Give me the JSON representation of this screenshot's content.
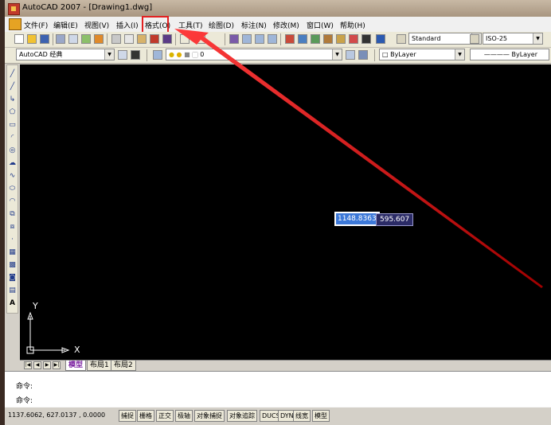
{
  "window": {
    "title": "AutoCAD 2007 - [Drawing1.dwg]"
  },
  "menu": [
    {
      "key": "file",
      "label": "文件(F)"
    },
    {
      "key": "edit",
      "label": "编辑(E)"
    },
    {
      "key": "view",
      "label": "视图(V)"
    },
    {
      "key": "insert",
      "label": "插入(I)"
    },
    {
      "key": "format",
      "label": "格式(O)"
    },
    {
      "key": "tools",
      "label": "工具(T)"
    },
    {
      "key": "draw",
      "label": "绘图(D)"
    },
    {
      "key": "dimension",
      "label": "标注(N)"
    },
    {
      "key": "modify",
      "label": "修改(M)"
    },
    {
      "key": "window",
      "label": "窗口(W)"
    },
    {
      "key": "help",
      "label": "帮助(H)"
    }
  ],
  "toolbar": {
    "text_style": "Standard",
    "dim_style": "ISO-25",
    "workspace": "AutoCAD 经典",
    "layer": "0",
    "color": "ByLayer",
    "linetype": "ByLayer"
  },
  "canvas": {
    "input_x": "1148.8363",
    "input_y": "595.607",
    "axis_x": "X",
    "axis_y": "Y"
  },
  "tabs": [
    {
      "key": "model",
      "label": "模型",
      "active": true
    },
    {
      "key": "layout1",
      "label": "布局1",
      "active": false
    },
    {
      "key": "layout2",
      "label": "布局2",
      "active": false
    }
  ],
  "command": {
    "line1": "命令:",
    "line2": "命令:"
  },
  "status": {
    "coords": "1137.6062, 627.0137 , 0.0000",
    "buttons": [
      "捕捉",
      "栅格",
      "正交",
      "极轴",
      "对象捕捉",
      "对象追踪",
      "DUCS",
      "DYN",
      "线宽",
      "模型"
    ]
  },
  "colors": {
    "accent_red": "#e22020",
    "canvas_bg": "#000000",
    "input_bg": "#3c78d8"
  }
}
